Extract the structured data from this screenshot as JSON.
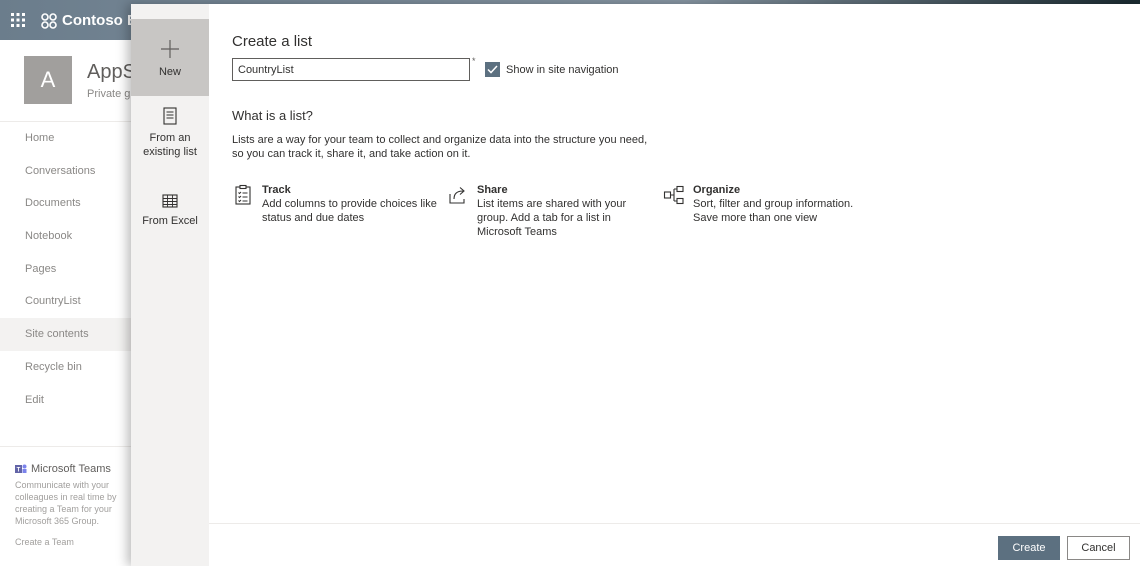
{
  "suite": {
    "brand": "Contoso Ele"
  },
  "site": {
    "avatar_letter": "A",
    "name": "AppS",
    "subtitle": "Private gr"
  },
  "left_nav": [
    {
      "label": "Home"
    },
    {
      "label": "Conversations"
    },
    {
      "label": "Documents"
    },
    {
      "label": "Notebook"
    },
    {
      "label": "Pages"
    },
    {
      "label": "CountryList"
    },
    {
      "label": "Site contents"
    },
    {
      "label": "Recycle bin"
    },
    {
      "label": "Edit"
    }
  ],
  "teams": {
    "title": "Microsoft Teams",
    "desc": "Communicate with your colleagues in real time by creating a Team for your Microsoft 365 Group.",
    "link": "Create a Team"
  },
  "tabs": [
    {
      "label": "New",
      "selected": true,
      "icon": "plus-icon"
    },
    {
      "label": "From an existing list",
      "selected": false,
      "icon": "list-document-icon"
    },
    {
      "label": "From Excel",
      "selected": false,
      "icon": "excel-table-icon"
    }
  ],
  "form": {
    "title": "Create a list",
    "name_value": "CountryList",
    "required_marker": "*",
    "show_in_nav_label": "Show in site navigation",
    "show_in_nav_checked": true
  },
  "info": {
    "title": "What is a list?",
    "desc": "Lists are a way for your team to collect and organize data into the structure you need, so you can track it, share it, and take action on it.",
    "features": [
      {
        "title": "Track",
        "desc": "Add columns to provide choices like status and due dates",
        "icon": "clipboard-checklist-icon"
      },
      {
        "title": "Share",
        "desc": "List items are shared with your group. Add a tab for a list in Microsoft Teams",
        "icon": "share-icon"
      },
      {
        "title": "Organize",
        "desc": "Sort, filter and group information. Save more than one view",
        "icon": "organize-hierarchy-icon"
      }
    ]
  },
  "footer": {
    "create_label": "Create",
    "cancel_label": "Cancel"
  },
  "colors": {
    "accent": "#5c7080",
    "tab_selected": "#c8c6c4",
    "tab_bg": "#f3f2f1"
  }
}
